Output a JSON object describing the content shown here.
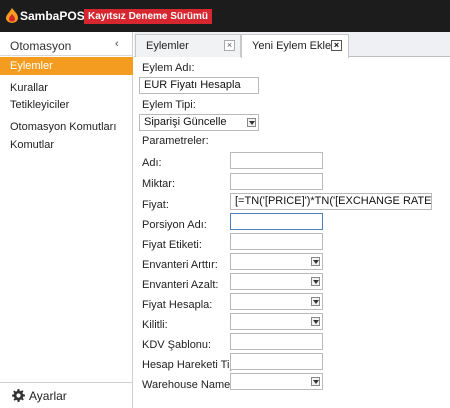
{
  "app": {
    "name": "SambaPOS",
    "trial_badge": "Kayıtsız Deneme Sürümü",
    "brand_color": "#f39c1f",
    "logo_icon": "samba-logo-icon"
  },
  "sidebar": {
    "header": "Otomasyon",
    "collapse_glyph": "‹",
    "items": [
      {
        "label": "Eylemler",
        "active": true
      },
      {
        "label": "Kurallar"
      },
      {
        "label": "Tetikleyiciler"
      },
      {
        "label": "Otomasyon Komutları"
      },
      {
        "label": "Komutlar"
      }
    ],
    "footer_label": "Ayarlar",
    "footer_icon": "gear-icon"
  },
  "tabs": [
    {
      "label": "Eylemler",
      "close": "×"
    },
    {
      "label": "Yeni Eylem Ekle",
      "close": "×",
      "active": true
    }
  ],
  "form": {
    "action_name_label": "Eylem Adı:",
    "action_name_value": "EUR Fiyatı Hesapla",
    "action_type_label": "Eylem Tipi:",
    "action_type_value": "Siparişi Güncelle",
    "parameters_label": "Parametreler:",
    "params": [
      {
        "label": "Adı:",
        "kind": "text",
        "value": ""
      },
      {
        "label": "Miktar:",
        "kind": "text",
        "value": ""
      },
      {
        "label": "Fiyat:",
        "kind": "text",
        "value": "[=TN('[PRICE]')*TN('[EXCHANGE RATE:USD]')]"
      },
      {
        "label": "Porsiyon Adı:",
        "kind": "text",
        "value": "",
        "focused": true
      },
      {
        "label": "Fiyat Etiketi:",
        "kind": "text",
        "value": ""
      },
      {
        "label": "Envanteri Arttır:",
        "kind": "select",
        "value": ""
      },
      {
        "label": "Envanteri Azalt:",
        "kind": "select",
        "value": ""
      },
      {
        "label": "Fiyat Hesapla:",
        "kind": "select",
        "value": ""
      },
      {
        "label": "Kilitli:",
        "kind": "select",
        "value": ""
      },
      {
        "label": "KDV Şablonu:",
        "kind": "text",
        "value": ""
      },
      {
        "label": "Hesap Hareketi Tipi:",
        "kind": "text",
        "value": ""
      },
      {
        "label": "Warehouse Name:",
        "kind": "select",
        "value": ""
      }
    ]
  }
}
